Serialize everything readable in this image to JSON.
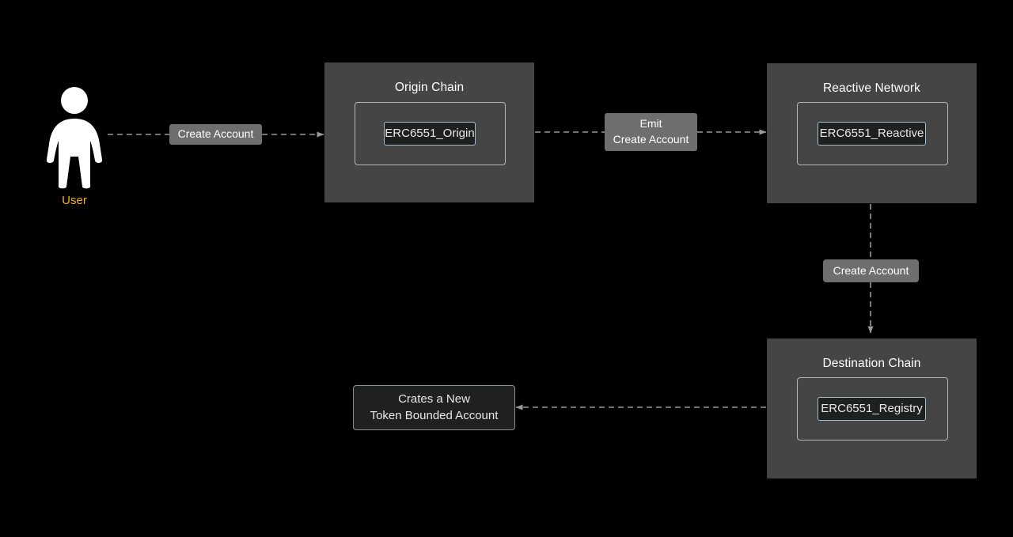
{
  "diagram": {
    "background_color": "#000000",
    "actor": {
      "name": "actor-user",
      "label": "User",
      "label_color": "#f2b01e",
      "figure_color": "#ffffff"
    },
    "subgraphs": [
      {
        "id": "origin-chain",
        "title": "Origin Chain",
        "fill": "#454545",
        "node": {
          "id": "erc6551-origin",
          "label": "ERC6551_Origin",
          "fill": "#1f2020",
          "stroke": "#a6bdd1"
        }
      },
      {
        "id": "reactive-network",
        "title": "Reactive Network",
        "fill": "#454545",
        "node": {
          "id": "erc6551-reactive",
          "label": "ERC6551_Reactive",
          "fill": "#1f2020",
          "stroke": "#a6bdd1"
        }
      },
      {
        "id": "destination-chain",
        "title": "Destination Chain",
        "fill": "#454545",
        "node": {
          "id": "erc6551-registry",
          "label": "ERC6551_Registry",
          "fill": "#1f2020",
          "stroke": "#a6bdd1"
        }
      }
    ],
    "standalone_nodes": [
      {
        "id": "token-bounded-account",
        "line1": "Crates a New",
        "line2": "Token Bounded Account",
        "fill": "#1f2020",
        "stroke": "#8f8f8f"
      }
    ],
    "edges": [
      {
        "id": "edge-user-to-origin",
        "from": "actor-user",
        "to": "erc6551-origin",
        "label_line1": "Create Account",
        "label_line2": "",
        "style": "dashed",
        "arrow": "end",
        "color": "#999999"
      },
      {
        "id": "edge-origin-to-reactive",
        "from": "erc6551-origin",
        "to": "erc6551-reactive",
        "label_line1": "Emit",
        "label_line2": "Create Account",
        "style": "dashed",
        "arrow": "end",
        "color": "#999999"
      },
      {
        "id": "edge-reactive-to-destination",
        "from": "erc6551-reactive",
        "to": "erc6551-registry",
        "label_line1": "Create Account",
        "label_line2": "",
        "style": "dashed",
        "arrow": "end",
        "color": "#999999"
      },
      {
        "id": "edge-registry-to-tba",
        "from": "erc6551-registry",
        "to": "token-bounded-account",
        "label_line1": "",
        "label_line2": "",
        "style": "dashed",
        "arrow": "end",
        "color": "#999999"
      }
    ]
  }
}
